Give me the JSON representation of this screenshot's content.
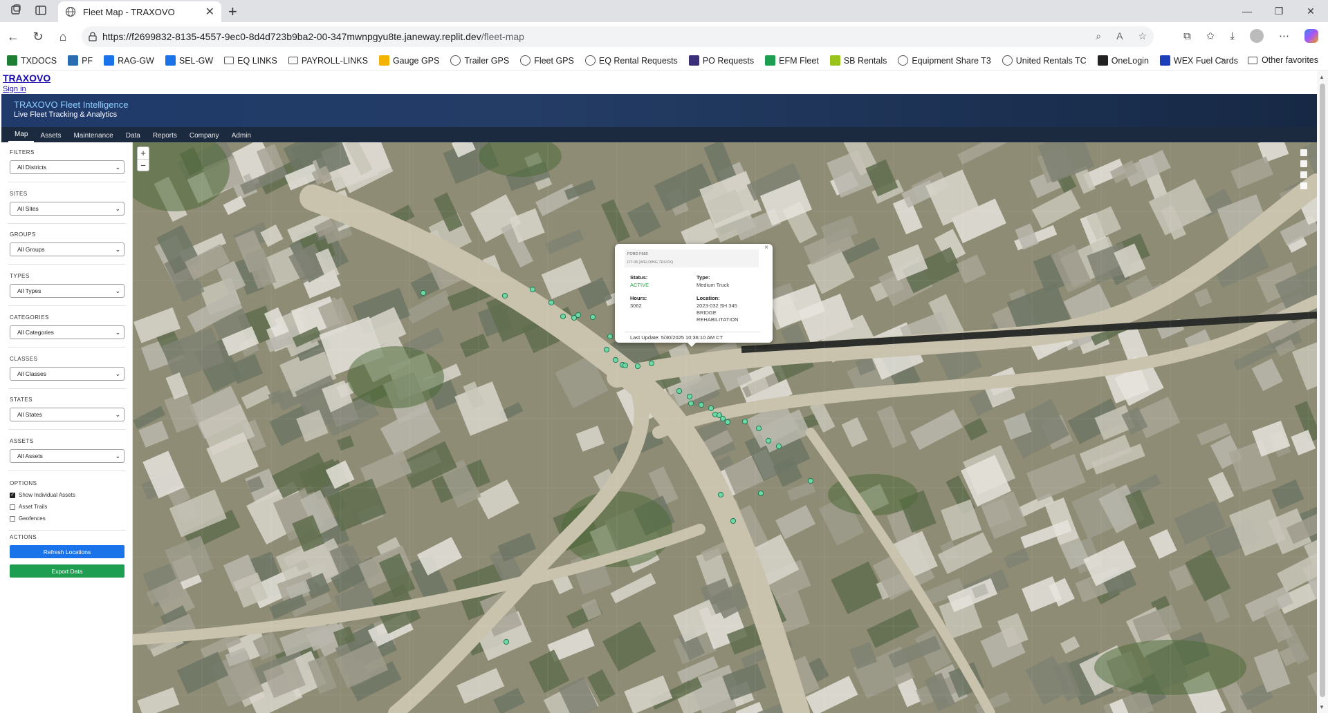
{
  "browser": {
    "tab_title": "Fleet Map - TRAXOVO",
    "url_host": "https://f2699832-8135-4557-9ec0-8d4d723b9ba2-00-347mwnpgyu8te.janeway.replit.dev",
    "url_path": "/fleet-map",
    "bookmarks": [
      {
        "label": "TXDOCS",
        "icon": "bookmark-site-icon",
        "color": "#1e7e34"
      },
      {
        "label": "PF",
        "icon": "bookmark-site-icon",
        "color": "#2b6cb0"
      },
      {
        "label": "RAG-GW",
        "icon": "bookmark-site-icon",
        "color": "#1a73e8"
      },
      {
        "label": "SEL-GW",
        "icon": "bookmark-site-icon",
        "color": "#1a73e8"
      },
      {
        "label": "EQ LINKS",
        "icon": "folder-icon",
        "color": "#ffffff"
      },
      {
        "label": "PAYROLL-LINKS",
        "icon": "folder-icon",
        "color": "#ffffff"
      },
      {
        "label": "Gauge GPS",
        "icon": "bookmark-site-icon",
        "color": "#f2b400"
      },
      {
        "label": "Trailer GPS",
        "icon": "globe-icon",
        "color": "#ffffff"
      },
      {
        "label": "Fleet GPS",
        "icon": "globe-icon",
        "color": "#ffffff"
      },
      {
        "label": "EQ Rental Requests",
        "icon": "globe-icon",
        "color": "#ffffff"
      },
      {
        "label": "PO Requests",
        "icon": "bookmark-site-icon",
        "color": "#3b2f7a"
      },
      {
        "label": "EFM Fleet",
        "icon": "bookmark-site-icon",
        "color": "#1e9e50"
      },
      {
        "label": "SB Rentals",
        "icon": "bookmark-site-icon",
        "color": "#9bc41a"
      },
      {
        "label": "Equipment Share T3",
        "icon": "globe-icon",
        "color": "#ffffff"
      },
      {
        "label": "United Rentals TC",
        "icon": "globe-icon",
        "color": "#ffffff"
      },
      {
        "label": "OneLogin",
        "icon": "bookmark-site-icon",
        "color": "#222222"
      },
      {
        "label": "WEX Fuel Cards",
        "icon": "bookmark-site-icon",
        "color": "#1d3fbb"
      }
    ],
    "other_favorites": "Other favorites"
  },
  "app": {
    "brand": "TRAXOVO",
    "sign_in": "Sign in",
    "hero_title": "TRAXOVO Fleet Intelligence",
    "hero_subtitle": "Live Fleet Tracking & Analytics",
    "menu": [
      "Map",
      "Assets",
      "Maintenance",
      "Data",
      "Reports",
      "Company",
      "Admin"
    ]
  },
  "sidebar": {
    "filters": [
      {
        "label": "FILTERS",
        "value": "All Districts"
      },
      {
        "label": "SITES",
        "value": "All Sites"
      },
      {
        "label": "GROUPS",
        "value": "All Groups"
      },
      {
        "label": "TYPES",
        "value": "All Types"
      },
      {
        "label": "CATEGORIES",
        "value": "All Categories"
      },
      {
        "label": "CLASSES",
        "value": "All Classes"
      },
      {
        "label": "STATES",
        "value": "All States"
      },
      {
        "label": "ASSETS",
        "value": "All Assets"
      }
    ],
    "options_label": "OPTIONS",
    "options": [
      {
        "label": "Show Individual Assets",
        "checked": true
      },
      {
        "label": "Asset Trails",
        "checked": false
      },
      {
        "label": "Geofences",
        "checked": false
      }
    ],
    "actions_label": "ACTIONS",
    "refresh_label": "Refresh Locations",
    "export_label": "Export Data"
  },
  "map": {
    "zoom_in": "+",
    "zoom_out": "−",
    "marker_color": "#6fd6a6",
    "popup": {
      "asset_name": "FORD F550",
      "asset_sub": "DT-08 (WELDING TRUCK)",
      "status_label": "Status:",
      "status_value": "ACTIVE",
      "type_label": "Type:",
      "type_value": "Medium Truck",
      "hours_label": "Hours:",
      "hours_value": "3062",
      "location_label": "Location:",
      "location_line1": "2023-032 SH 345",
      "location_line2": "BRIDGE",
      "location_line3": "REHABILITATION",
      "last_update": "Last Update: 5/30/2025 10:36:10 AM CT",
      "close": "×"
    }
  }
}
